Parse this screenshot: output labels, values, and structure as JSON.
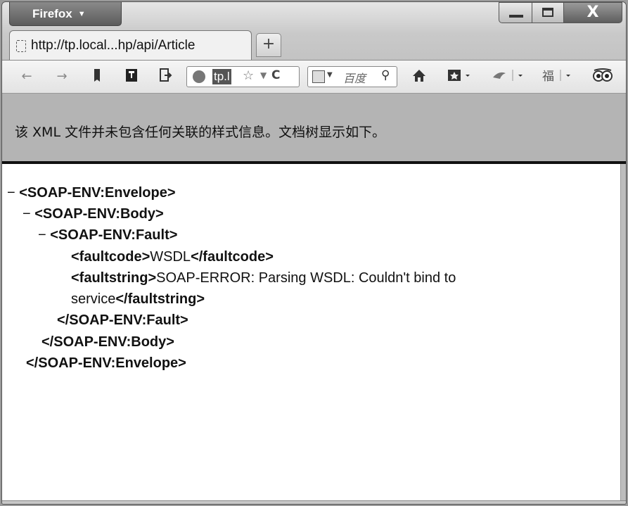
{
  "window": {
    "app_button": "Firefox",
    "controls": {
      "minimize": "",
      "maximize": "",
      "close": "X"
    }
  },
  "tab": {
    "title": "http://tp.local...hp/api/Article"
  },
  "new_tab_label": "+",
  "navbar": {
    "back": "←",
    "forward": "→",
    "url_visible": "tp.l",
    "search_placeholder": "百度",
    "icons": [
      "back-icon",
      "forward-icon",
      "bookmark-icon",
      "tag-icon",
      "share-icon",
      "globe-icon",
      "star-icon",
      "dropdown-icon",
      "reload-icon",
      "search-engine-icon",
      "search-icon",
      "home-icon",
      "addon-icon",
      "bird-icon",
      "plugin-icon",
      "owl-icon"
    ]
  },
  "info": {
    "message": "该 XML 文件并未包含任何关联的样式信息。文档树显示如下。"
  },
  "xml": {
    "collapse": "−",
    "envelope_open": "<SOAP-ENV:Envelope>",
    "body_open": "<SOAP-ENV:Body>",
    "fault_open": "<SOAP-ENV:Fault>",
    "faultcode_open": "<faultcode>",
    "faultcode_value": "WSDL",
    "faultcode_close": "</faultcode>",
    "faultstring_open": "<faultstring>",
    "faultstring_value_1": "SOAP-ERROR: Parsing WSDL: Couldn't bind to",
    "faultstring_value_2": "service",
    "faultstring_close": "</faultstring>",
    "fault_close": "</SOAP-ENV:Fault>",
    "body_close": "</SOAP-ENV:Body>",
    "envelope_close": "</SOAP-ENV:Envelope>"
  }
}
